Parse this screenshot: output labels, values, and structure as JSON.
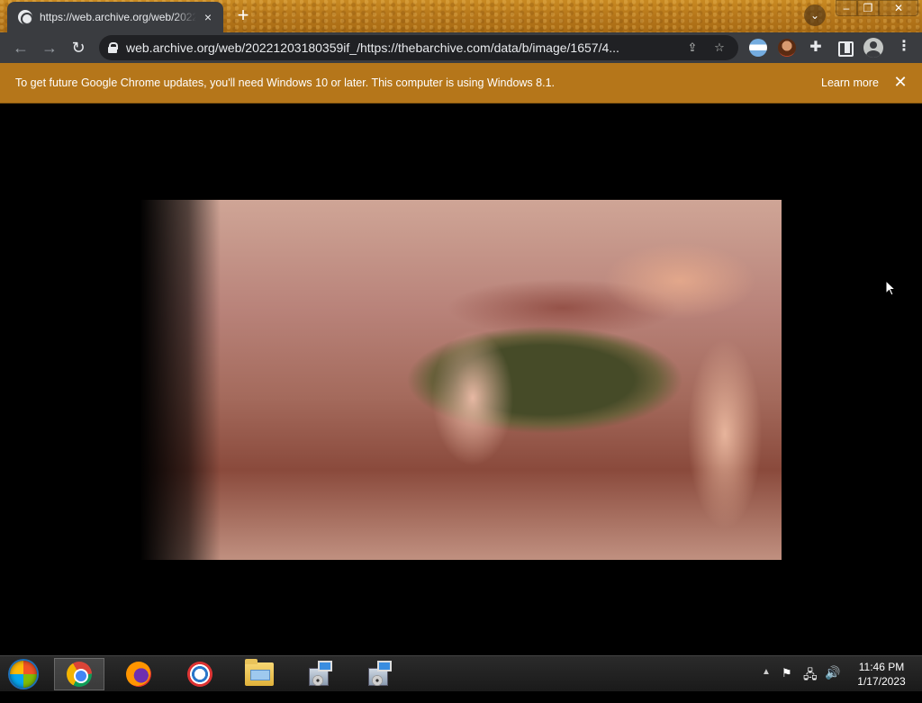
{
  "browser": {
    "tab": {
      "title": "https://web.archive.org/web/2022",
      "close_glyph": "×"
    },
    "new_tab_glyph": "+",
    "tab_search_glyph": "⌄",
    "window_controls": {
      "minimize": "–",
      "maximize": "❐",
      "close": "✕"
    },
    "toolbar": {
      "back_glyph": "←",
      "forward_glyph": "→",
      "reload_glyph": "↻",
      "url": "web.archive.org/web/20221203180359if_/https://thebarchive.com/data/b/image/1657/4...",
      "share_glyph": "⇪",
      "bookmark_glyph": "☆",
      "puzzle_glyph": "✚",
      "menu_glyph": "⋮"
    },
    "infobar": {
      "message": "To get future Google Chrome updates, you'll need Windows 10 or later. This computer is using Windows 8.1.",
      "learn_more": "Learn more",
      "close_glyph": "✕"
    }
  },
  "taskbar": {
    "apps": [
      {
        "name": "chrome",
        "active": true
      },
      {
        "name": "firefox",
        "active": false
      },
      {
        "name": "opera",
        "active": false
      },
      {
        "name": "file-explorer",
        "active": false
      },
      {
        "name": "setup-installer",
        "active": false
      },
      {
        "name": "setup-installer",
        "active": false
      }
    ],
    "tray": {
      "show_hidden_glyph": "▲",
      "flag_glyph": "⚑",
      "network_glyph": "🖧",
      "volume_glyph": "🔊"
    },
    "clock": {
      "time": "11:46 PM",
      "date": "1/17/2023"
    }
  }
}
